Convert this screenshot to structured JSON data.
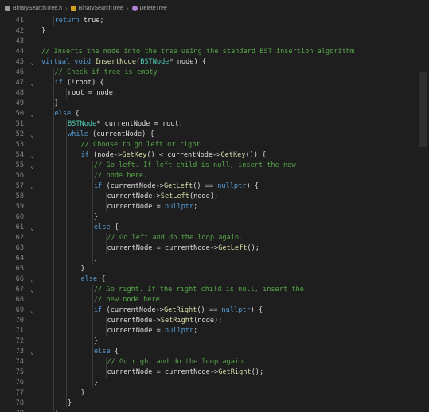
{
  "breadcrumb": {
    "items": [
      {
        "label": "BinarySearchTree.h",
        "icon": "cpp-file-icon",
        "color": "#9b9b9b"
      },
      {
        "label": "BinarySearchTree",
        "icon": "class-icon",
        "color": "#d0a020"
      },
      {
        "label": "DeleteTree",
        "icon": "method-icon",
        "color": "#b180d7"
      }
    ]
  },
  "colors": {
    "background": "#1e1e1e",
    "line_number": "#858585",
    "text": "#dcdcdc",
    "keyword": "#569cd6",
    "comment": "#57a64a",
    "type": "#4ec9b0",
    "function": "#dcdcaa"
  },
  "editor": {
    "lines": [
      {
        "n": "41",
        "indent": 2,
        "fold": "",
        "tokens": [
          [
            "kw",
            "return"
          ],
          [
            "pn",
            " true;"
          ]
        ]
      },
      {
        "n": "42",
        "indent": 1,
        "fold": "",
        "tokens": [
          [
            "pn",
            "}"
          ]
        ]
      },
      {
        "n": "43",
        "indent": 0,
        "fold": "",
        "tokens": []
      },
      {
        "n": "44",
        "indent": 1,
        "fold": "",
        "tokens": [
          [
            "cm",
            "// Inserts the node into the tree using the standard BST insertion algorithm"
          ]
        ]
      },
      {
        "n": "45",
        "indent": 1,
        "fold": "⌄",
        "tokens": [
          [
            "kw",
            "virtual void "
          ],
          [
            "fn",
            "InsertNode"
          ],
          [
            "pn",
            "("
          ],
          [
            "ty",
            "BSTNode"
          ],
          [
            "pn",
            "* node) {"
          ]
        ]
      },
      {
        "n": "46",
        "indent": 2,
        "fold": "",
        "tokens": [
          [
            "cm",
            "// Check if tree is empty"
          ]
        ]
      },
      {
        "n": "47",
        "indent": 2,
        "fold": "⌄",
        "tokens": [
          [
            "kw",
            "if"
          ],
          [
            "pn",
            " (!root) {"
          ]
        ]
      },
      {
        "n": "48",
        "indent": 3,
        "fold": "",
        "tokens": [
          [
            "pn",
            "root = node;"
          ]
        ]
      },
      {
        "n": "49",
        "indent": 2,
        "fold": "",
        "tokens": [
          [
            "pn",
            "}"
          ]
        ]
      },
      {
        "n": "50",
        "indent": 2,
        "fold": "⌄",
        "tokens": [
          [
            "kw",
            "else"
          ],
          [
            "pn",
            " {"
          ]
        ]
      },
      {
        "n": "51",
        "indent": 3,
        "fold": "",
        "tokens": [
          [
            "ty",
            "BSTNode"
          ],
          [
            "pn",
            "* currentNode = root;"
          ]
        ]
      },
      {
        "n": "52",
        "indent": 3,
        "fold": "⌄",
        "tokens": [
          [
            "kw",
            "while"
          ],
          [
            "pn",
            " (currentNode) {"
          ]
        ]
      },
      {
        "n": "53",
        "indent": 4,
        "fold": "",
        "tokens": [
          [
            "cm",
            "// Choose to go left or right"
          ]
        ]
      },
      {
        "n": "54",
        "indent": 4,
        "fold": "⌄",
        "tokens": [
          [
            "kw",
            "if"
          ],
          [
            "pn",
            " (node->"
          ],
          [
            "fn",
            "GetKey"
          ],
          [
            "pn",
            "() < currentNode->"
          ],
          [
            "fn",
            "GetKey"
          ],
          [
            "pn",
            "()) {"
          ]
        ]
      },
      {
        "n": "55",
        "indent": 5,
        "fold": "⌄",
        "tokens": [
          [
            "cm",
            "// Go left. If left child is null, insert the new"
          ]
        ]
      },
      {
        "n": "56",
        "indent": 5,
        "fold": "",
        "tokens": [
          [
            "cm",
            "// node here."
          ]
        ]
      },
      {
        "n": "57",
        "indent": 5,
        "fold": "⌄",
        "tokens": [
          [
            "kw",
            "if"
          ],
          [
            "pn",
            " (currentNode->"
          ],
          [
            "fn",
            "GetLeft"
          ],
          [
            "pn",
            "() == "
          ],
          [
            "kw",
            "nullptr"
          ],
          [
            "pn",
            ") {"
          ]
        ]
      },
      {
        "n": "58",
        "indent": 6,
        "fold": "",
        "tokens": [
          [
            "pn",
            "currentNode->"
          ],
          [
            "fn",
            "SetLeft"
          ],
          [
            "pn",
            "(node);"
          ]
        ]
      },
      {
        "n": "59",
        "indent": 6,
        "fold": "",
        "tokens": [
          [
            "pn",
            "currentNode = "
          ],
          [
            "kw",
            "nullptr"
          ],
          [
            "pn",
            ";"
          ]
        ]
      },
      {
        "n": "60",
        "indent": 5,
        "fold": "",
        "tokens": [
          [
            "pn",
            "}"
          ]
        ]
      },
      {
        "n": "61",
        "indent": 5,
        "fold": "⌄",
        "tokens": [
          [
            "kw",
            "else"
          ],
          [
            "pn",
            " {"
          ]
        ]
      },
      {
        "n": "62",
        "indent": 6,
        "fold": "",
        "tokens": [
          [
            "cm",
            "// Go left and do the loop again."
          ]
        ]
      },
      {
        "n": "63",
        "indent": 6,
        "fold": "",
        "tokens": [
          [
            "pn",
            "currentNode = currentNode->"
          ],
          [
            "fn",
            "GetLeft"
          ],
          [
            "pn",
            "();"
          ]
        ]
      },
      {
        "n": "64",
        "indent": 5,
        "fold": "",
        "tokens": [
          [
            "pn",
            "}"
          ]
        ]
      },
      {
        "n": "65",
        "indent": 4,
        "fold": "",
        "tokens": [
          [
            "pn",
            "}"
          ]
        ]
      },
      {
        "n": "66",
        "indent": 4,
        "fold": "⌄",
        "tokens": [
          [
            "kw",
            "else"
          ],
          [
            "pn",
            " {"
          ]
        ]
      },
      {
        "n": "67",
        "indent": 5,
        "fold": "⌄",
        "tokens": [
          [
            "cm",
            "// Go right. If the right child is null, insert the"
          ]
        ]
      },
      {
        "n": "68",
        "indent": 5,
        "fold": "",
        "tokens": [
          [
            "cm",
            "// new node here."
          ]
        ]
      },
      {
        "n": "69",
        "indent": 5,
        "fold": "⌄",
        "tokens": [
          [
            "kw",
            "if"
          ],
          [
            "pn",
            " (currentNode->"
          ],
          [
            "fn",
            "GetRight"
          ],
          [
            "pn",
            "() == "
          ],
          [
            "kw",
            "nullptr"
          ],
          [
            "pn",
            ") {"
          ]
        ]
      },
      {
        "n": "70",
        "indent": 6,
        "fold": "",
        "tokens": [
          [
            "pn",
            "currentNode->"
          ],
          [
            "fn",
            "SetRight"
          ],
          [
            "pn",
            "(node);"
          ]
        ]
      },
      {
        "n": "71",
        "indent": 6,
        "fold": "",
        "tokens": [
          [
            "pn",
            "currentNode = "
          ],
          [
            "kw",
            "nullptr"
          ],
          [
            "pn",
            ";"
          ]
        ]
      },
      {
        "n": "72",
        "indent": 5,
        "fold": "",
        "tokens": [
          [
            "pn",
            "}"
          ]
        ]
      },
      {
        "n": "73",
        "indent": 5,
        "fold": "⌄",
        "tokens": [
          [
            "kw",
            "else"
          ],
          [
            "pn",
            " {"
          ]
        ]
      },
      {
        "n": "74",
        "indent": 6,
        "fold": "",
        "tokens": [
          [
            "cm",
            "// Go right and do the loop again."
          ]
        ]
      },
      {
        "n": "75",
        "indent": 6,
        "fold": "",
        "tokens": [
          [
            "pn",
            "currentNode = currentNode->"
          ],
          [
            "fn",
            "GetRight"
          ],
          [
            "pn",
            "();"
          ]
        ]
      },
      {
        "n": "76",
        "indent": 5,
        "fold": "",
        "tokens": [
          [
            "pn",
            "}"
          ]
        ]
      },
      {
        "n": "77",
        "indent": 4,
        "fold": "",
        "tokens": [
          [
            "pn",
            "}"
          ]
        ]
      },
      {
        "n": "78",
        "indent": 3,
        "fold": "",
        "tokens": [
          [
            "pn",
            "}"
          ]
        ]
      },
      {
        "n": "79",
        "indent": 2,
        "fold": "",
        "tokens": [
          [
            "pn",
            "}"
          ]
        ]
      }
    ]
  }
}
